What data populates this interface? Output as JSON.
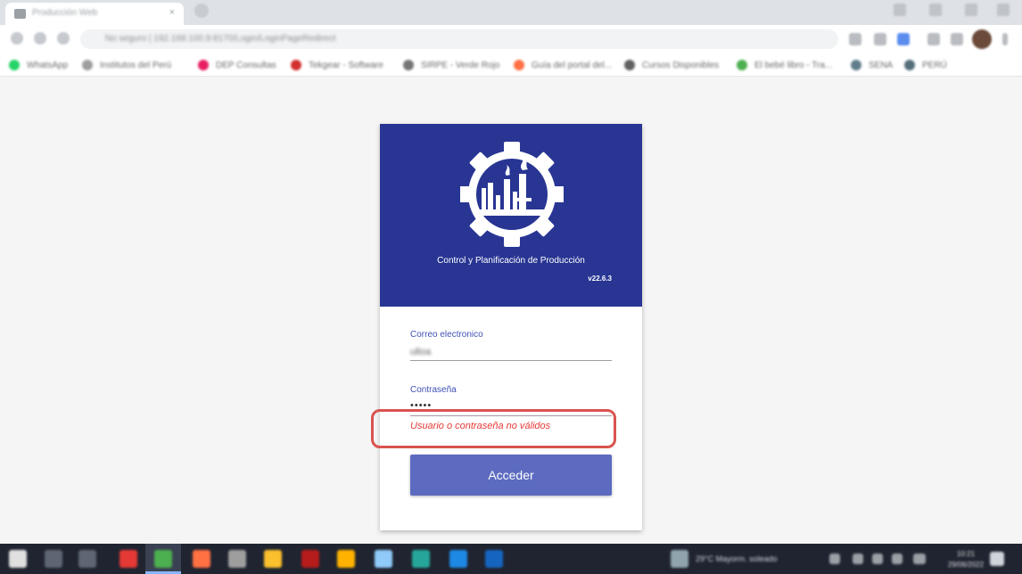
{
  "browser": {
    "tab_title": "Producción Web",
    "tab_close": "×",
    "address": "No seguro | 192.168.100.9:8170/Login/LoginPageRedirect",
    "bookmarks": [
      {
        "label": "WhatsApp",
        "color": "#25d366"
      },
      {
        "label": "Institutos del Perú",
        "color": "#9e9e9e"
      },
      {
        "label": "DEP Consultas",
        "color": "#e91e63"
      },
      {
        "label": "Tekgear - Software",
        "color": "#d32f2f"
      },
      {
        "label": "SIRPE - Verde Rojo",
        "color": "#757575"
      },
      {
        "label": "Guía del portal del...",
        "color": "#ff7043"
      },
      {
        "label": "Cursos Disponibles",
        "color": "#616161"
      },
      {
        "label": "El bebé libro - Tra...",
        "color": "#4caf50"
      },
      {
        "label": "SENA",
        "color": "#607d8b"
      },
      {
        "label": "PERÚ",
        "color": "#546e7a"
      }
    ]
  },
  "login": {
    "app_title": "Control y Planificación de Producción",
    "version": "v22.6.3",
    "email_label": "Correo electronico",
    "email_value": "ulloa",
    "password_label": "Contraseña",
    "password_value": "•••••",
    "error_message": "Usuario o contraseña no válidos",
    "submit_label": "Acceder"
  },
  "colors": {
    "header": "#283593",
    "accent": "#3f51b5",
    "button": "#5c6bc0",
    "error": "#e53935",
    "highlight": "#d9534f"
  },
  "taskbar": {
    "weather": "29°C Mayorm. soleado",
    "time": "10:21",
    "date": "29/06/2022",
    "apps": [
      {
        "name": "windows-start-icon",
        "color": "#e0e0e0"
      },
      {
        "name": "search-icon",
        "color": "#9e9e9e"
      },
      {
        "name": "task-view-icon",
        "color": "#9e9e9e"
      },
      {
        "name": "app-red-icon",
        "color": "#e53935"
      },
      {
        "name": "chrome-icon",
        "color": "#4caf50"
      },
      {
        "name": "app-colorful-icon",
        "color": "#ff7043"
      },
      {
        "name": "app-gray-icon",
        "color": "#9e9e9e"
      },
      {
        "name": "file-explorer-icon",
        "color": "#fbc02d"
      },
      {
        "name": "app-dark-red-icon",
        "color": "#b71c1c"
      },
      {
        "name": "app-yellow-icon",
        "color": "#ffb300"
      },
      {
        "name": "app-blue-icon",
        "color": "#90caf9"
      },
      {
        "name": "edge-icon",
        "color": "#26a69a"
      },
      {
        "name": "outlook-icon",
        "color": "#1e88e5"
      },
      {
        "name": "app-word-icon",
        "color": "#1565c0"
      }
    ]
  }
}
